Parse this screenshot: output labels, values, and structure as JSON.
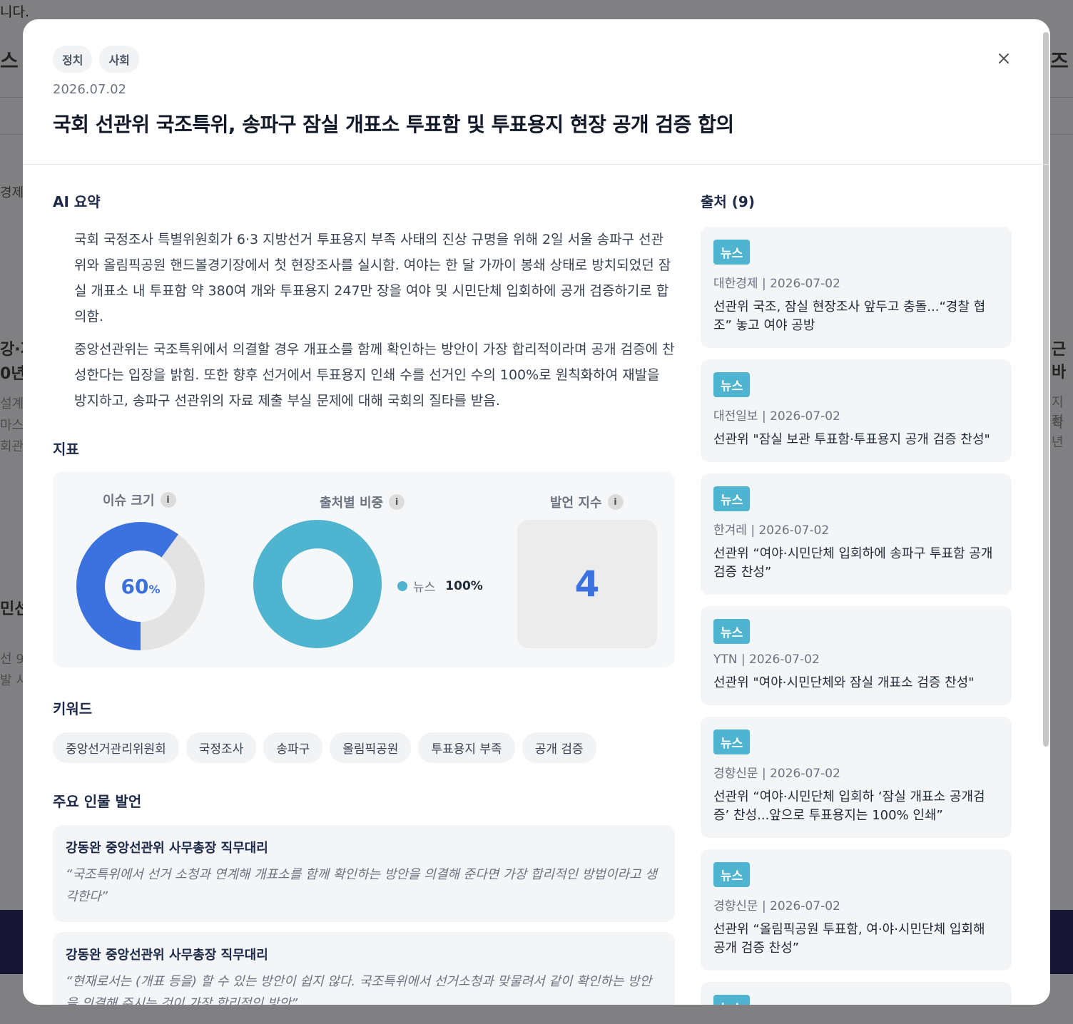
{
  "background": {
    "top_text": "니다.",
    "fragments": [
      "스",
      "즈",
      "경제",
      "강·지",
      "0년",
      "설계",
      "마스",
      "회관",
      "민선",
      "선 9",
      "발 시",
      "근 바",
      "지정",
      "작년"
    ]
  },
  "modal": {
    "tags": [
      "정치",
      "사회"
    ],
    "date": "2026.07.02",
    "title": "국회 선관위 국조특위, 송파구 잠실 개표소 투표함 및 투표용지 현장 공개 검증 합의",
    "close_label": "×",
    "summary": {
      "heading": "AI 요약",
      "paragraphs": [
        "국회 국정조사 특별위원회가 6·3 지방선거 투표용지 부족 사태의 진상 규명을 위해 2일 서울 송파구 선관위와 올림픽공원 핸드볼경기장에서 첫 현장조사를 실시함. 여야는 한 달 가까이 봉쇄 상태로 방치되었던 잠실 개표소 내 투표함 약 380여 개와 투표용지 247만 장을 여야 및 시민단체 입회하에 공개 검증하기로 합의함.",
        "중앙선관위는 국조특위에서 의결할 경우 개표소를 함께 확인하는 방안이 가장 합리적이라며 공개 검증에 찬성한다는 입장을 밝힘. 또한 향후 선거에서 투표용지 인쇄 수를 선거인 수의 100%로 원칙화하여 재발을 방지하고, 송파구 선관위의 자료 제출 부실 문제에 대해 국회의 질타를 받음."
      ]
    },
    "metrics": {
      "heading": "지표",
      "issue_size": {
        "label": "이슈 크기",
        "value": 60,
        "unit": "%",
        "info_icon": "info-icon"
      },
      "source_share": {
        "label": "출처별 비중",
        "items": [
          {
            "name": "뉴스",
            "value_text": "100%",
            "value": 100,
            "color": "#4fb4d0"
          }
        ],
        "info_icon": "info-icon"
      },
      "speech_index": {
        "label": "발언 지수",
        "value": "4",
        "info_icon": "info-icon"
      },
      "colors": {
        "primary": "#3b72e0",
        "track": "#e3e3e3",
        "news": "#4fb4d0"
      }
    },
    "keywords": {
      "heading": "키워드",
      "items": [
        "중앙선거관리위원회",
        "국정조사",
        "송파구",
        "올림픽공원",
        "투표용지 부족",
        "공개 검증"
      ]
    },
    "quotes": {
      "heading": "주요 인물 발언",
      "items": [
        {
          "speaker": "강동완 중앙선관위 사무총장 직무대리",
          "text": "“국조특위에서 선거 소청과 연계해 개표소를 함께 확인하는 방안을 의결해 준다면 가장 합리적인 방법이라고 생각한다”"
        },
        {
          "speaker": "강동완 중앙선관위 사무총장 직무대리",
          "text": "“현재로서는 (개표 등을) 할 수 있는 방안이 쉽지 않다. 국조특위에서 선거소청과 맞물려서 같이 확인하는 방안을 의결해 주시는 것이 가장 합리적인 방안”"
        }
      ]
    },
    "sources": {
      "heading": "출처 (9)",
      "items": [
        {
          "badge": "뉴스",
          "meta": "대한경제 | 2026-07-02",
          "title": "선관위 국조, 잠실 현장조사 앞두고 충돌...“경찰 협조” 놓고 여야 공방"
        },
        {
          "badge": "뉴스",
          "meta": "대전일보 | 2026-07-02",
          "title": "선관위 \"잠실 보관 투표함·투표용지 공개 검증 찬성\""
        },
        {
          "badge": "뉴스",
          "meta": "한겨레 | 2026-07-02",
          "title": "선관위 “여야·시민단체 입회하에 송파구 투표함 공개 검증 찬성”"
        },
        {
          "badge": "뉴스",
          "meta": "YTN | 2026-07-02",
          "title": "선관위 \"여야·시민단체와 잠실 개표소 검증 찬성\""
        },
        {
          "badge": "뉴스",
          "meta": "경향신문 | 2026-07-02",
          "title": "선관위 “여야·시민단체 입회하 ‘잠실 개표소 공개검증’ 찬성...앞으로 투표용지는 100% 인쇄”"
        },
        {
          "badge": "뉴스",
          "meta": "경향신문 | 2026-07-02",
          "title": "선관위 “올림픽공원 투표함, 여·야·시민단체 입회해 공개 검증 찬성”"
        },
        {
          "badge": "뉴스",
          "meta": "",
          "title": ""
        }
      ]
    }
  }
}
